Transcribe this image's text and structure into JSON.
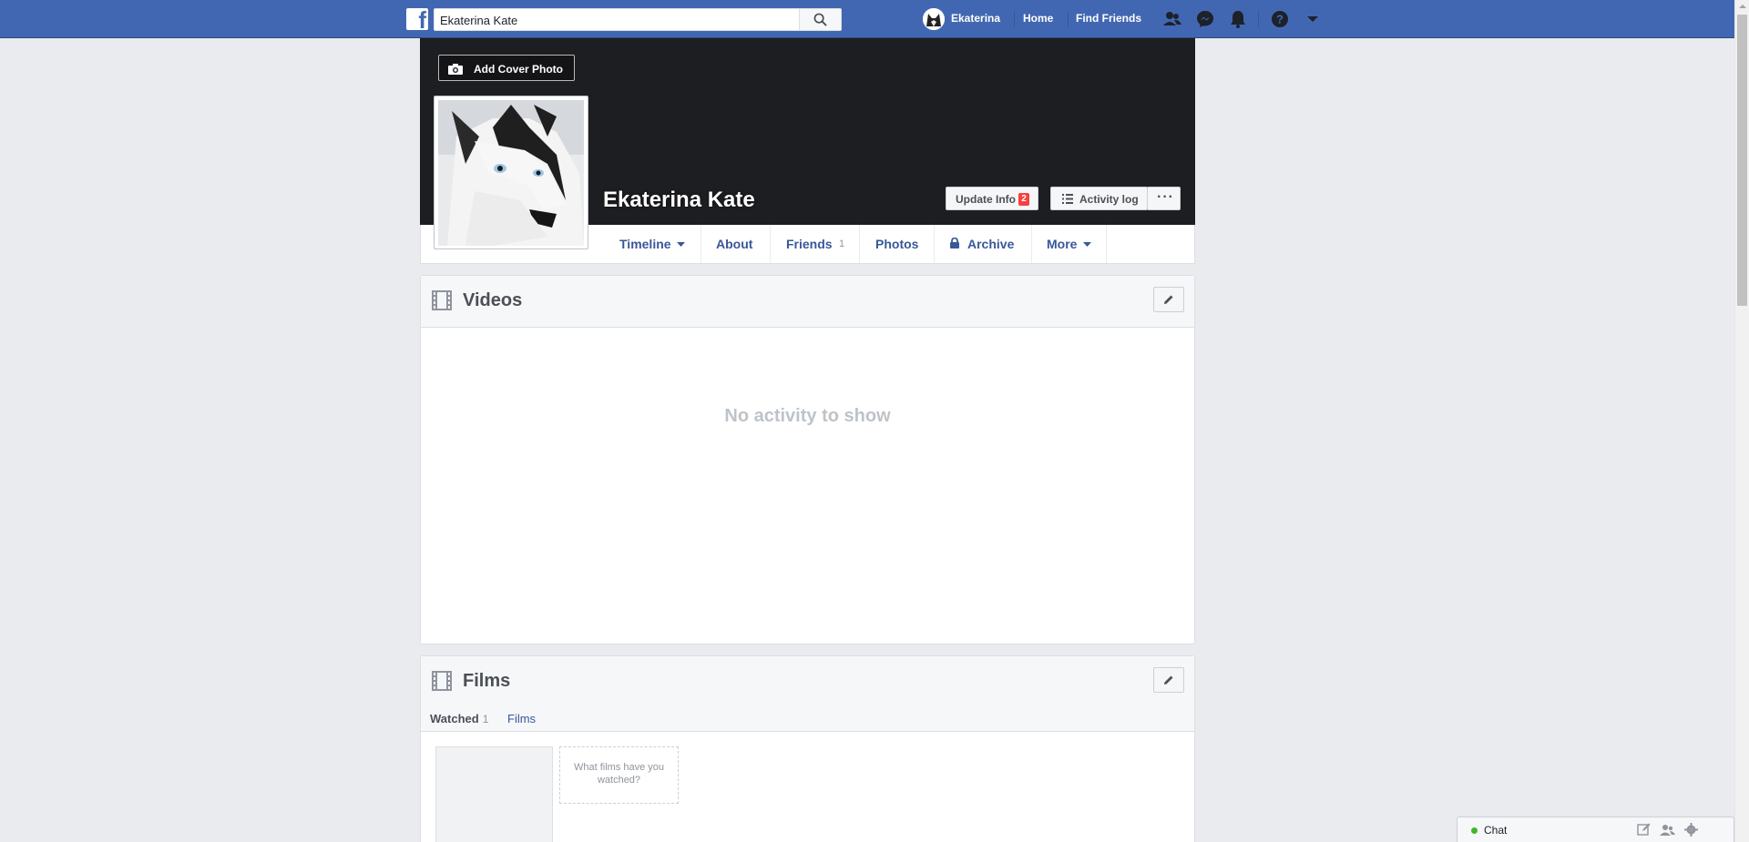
{
  "topbar": {
    "search_value": "Ekaterina Kate",
    "user_name": "Ekaterina",
    "home_label": "Home",
    "find_friends_label": "Find Friends"
  },
  "profile": {
    "name": "Ekaterina Kate",
    "add_cover_label": "Add Cover Photo",
    "update_info_label": "Update Info",
    "update_info_badge": "2",
    "activity_log_label": "Activity log",
    "more_options_label": "···"
  },
  "tabs": [
    {
      "label": "Timeline"
    },
    {
      "label": "About"
    },
    {
      "label": "Friends",
      "count": "1"
    },
    {
      "label": "Photos"
    },
    {
      "label": "Archive"
    },
    {
      "label": "More"
    }
  ],
  "videos": {
    "title": "Videos",
    "empty_message": "No activity to show"
  },
  "films": {
    "title": "Films",
    "subtab_watched": "Watched",
    "subtab_watched_count": "1",
    "subtab_films": "Films",
    "prompt": "What films have you watched?"
  },
  "chat": {
    "label": "Chat",
    "online_color": "#42b72a"
  },
  "colors": {
    "brand_blue": "#4267b2",
    "link_blue": "#385898",
    "cover_dark": "#1d1e21",
    "badge_red": "#fa3e3e"
  }
}
